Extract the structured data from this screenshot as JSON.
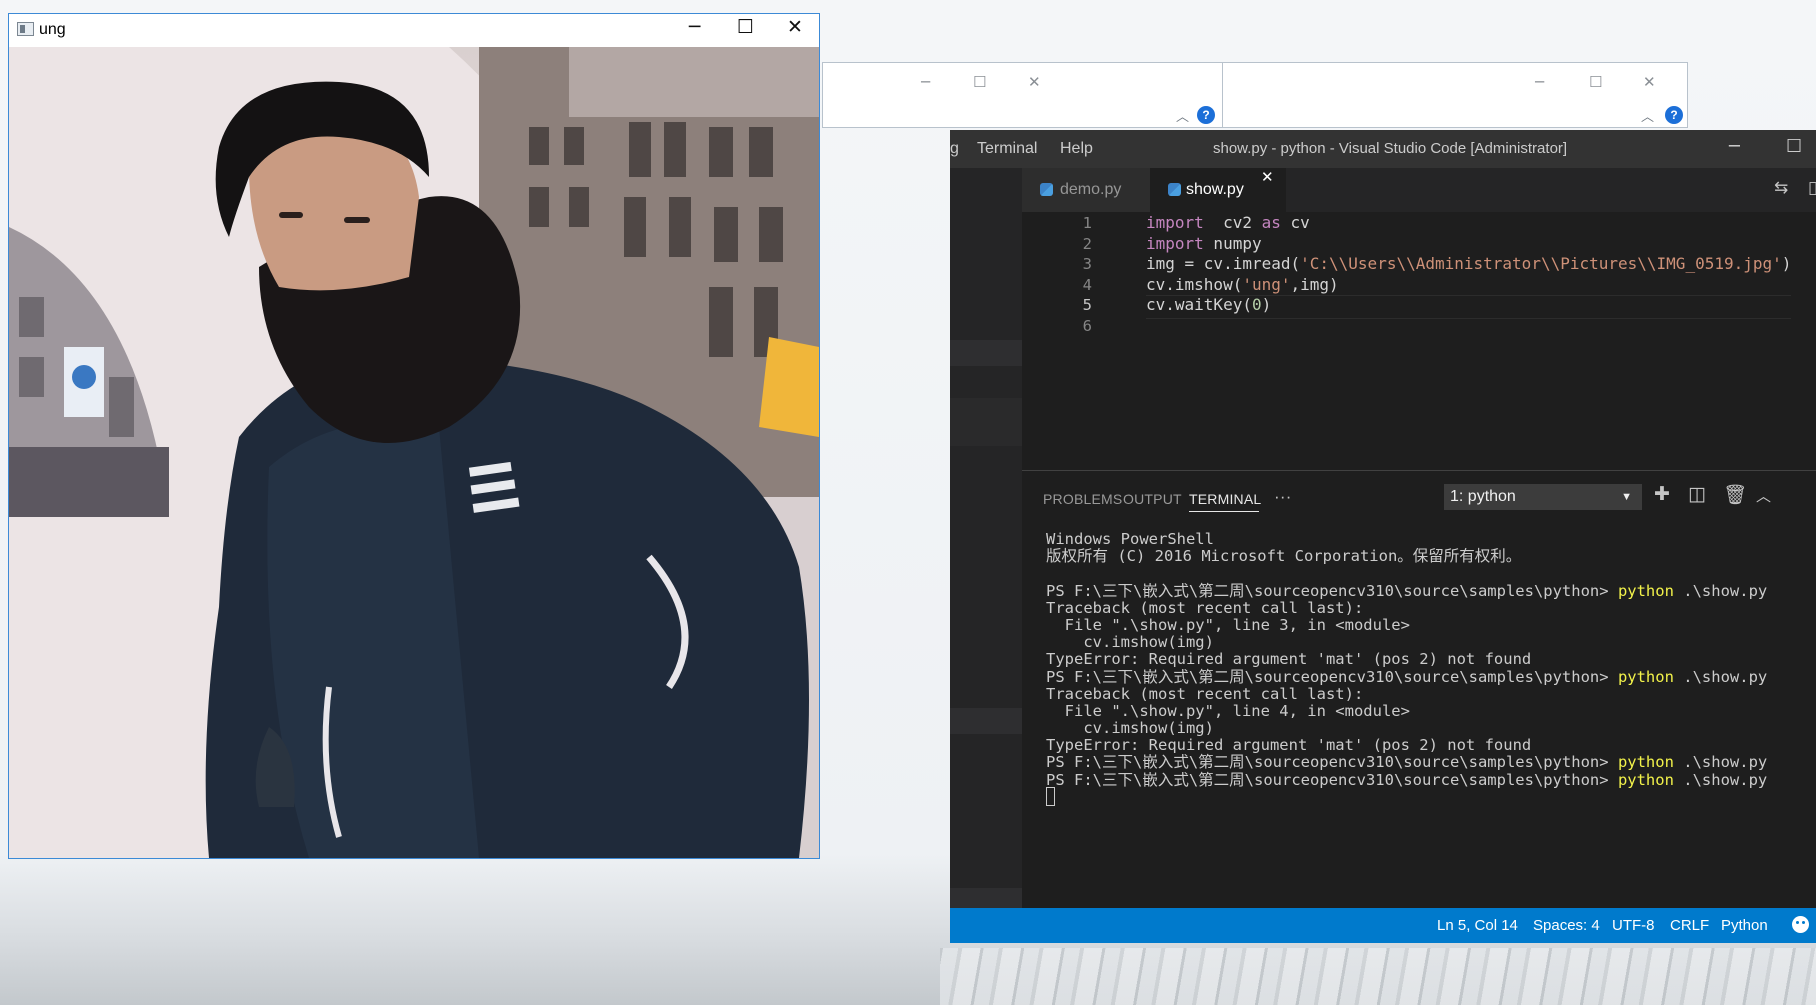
{
  "image_window": {
    "title": "ung",
    "controls": {
      "minimize": "─",
      "maximize": "☐",
      "close": "✕"
    }
  },
  "bg_windows": [
    {
      "minimize": "─",
      "maximize": "☐",
      "close": "✕",
      "chevron": "︿",
      "help": "?"
    },
    {
      "minimize": "─",
      "maximize": "☐",
      "close": "✕",
      "chevron": "︿",
      "help": "?"
    }
  ],
  "vscode": {
    "menu": [
      "g",
      "Terminal",
      "Help"
    ],
    "window_title": "show.py - python - Visual Studio Code [Administrator]",
    "window_controls": {
      "minimize": "─",
      "maximize": "☐"
    },
    "tabs": [
      {
        "label": "demo.py",
        "active": false
      },
      {
        "label": "show.py",
        "active": true,
        "close": "✕"
      }
    ],
    "code_lines": [
      {
        "n": "1",
        "parts": [
          [
            "kw",
            "import"
          ],
          [
            "",
            "  cv2 "
          ],
          [
            "kw",
            "as"
          ],
          [
            "",
            " cv"
          ]
        ]
      },
      {
        "n": "2",
        "parts": [
          [
            "kw",
            "import"
          ],
          [
            "",
            " numpy"
          ]
        ]
      },
      {
        "n": "3",
        "parts": [
          [
            "",
            "img = cv.imread("
          ],
          [
            "str",
            "'C:\\\\Users\\\\Administrator\\\\Pictures\\\\IMG_0519.jpg'"
          ],
          [
            "",
            ")"
          ]
        ]
      },
      {
        "n": "4",
        "parts": [
          [
            "",
            "cv.imshow("
          ],
          [
            "str",
            "'ung'"
          ],
          [
            "",
            ",img)"
          ]
        ]
      },
      {
        "n": "5",
        "parts": [
          [
            "",
            "cv.waitKey("
          ],
          [
            "num",
            "0"
          ],
          [
            "",
            ")"
          ]
        ]
      },
      {
        "n": "6",
        "parts": []
      }
    ],
    "panel": {
      "tabs": [
        "PROBLEMS",
        "OUTPUT",
        "TERMINAL"
      ],
      "active_tab": "TERMINAL",
      "more": "···",
      "terminal_select": "1: python",
      "terminal_lines": [
        [
          [
            "",
            "Windows PowerShell"
          ]
        ],
        [
          [
            "",
            "版权所有 (C) 2016 Microsoft Corporation。保留所有权利。"
          ]
        ],
        [
          [
            "",
            ""
          ]
        ],
        [
          [
            "",
            "PS F:\\三下\\嵌入式\\第二周\\sourceopencv310\\source\\samples\\python> "
          ],
          [
            "yel",
            "python"
          ],
          [
            "",
            " .\\show.py"
          ]
        ],
        [
          [
            "",
            "Traceback (most recent call last):"
          ]
        ],
        [
          [
            "",
            "  File \".\\show.py\", line 3, in <module>"
          ]
        ],
        [
          [
            "",
            "    cv.imshow(img)"
          ]
        ],
        [
          [
            "",
            "TypeError: Required argument 'mat' (pos 2) not found"
          ]
        ],
        [
          [
            "",
            "PS F:\\三下\\嵌入式\\第二周\\sourceopencv310\\source\\samples\\python> "
          ],
          [
            "yel",
            "python"
          ],
          [
            "",
            " .\\show.py"
          ]
        ],
        [
          [
            "",
            "Traceback (most recent call last):"
          ]
        ],
        [
          [
            "",
            "  File \".\\show.py\", line 4, in <module>"
          ]
        ],
        [
          [
            "",
            "    cv.imshow(img)"
          ]
        ],
        [
          [
            "",
            "TypeError: Required argument 'mat' (pos 2) not found"
          ]
        ],
        [
          [
            "",
            "PS F:\\三下\\嵌入式\\第二周\\sourceopencv310\\source\\samples\\python> "
          ],
          [
            "yel",
            "python"
          ],
          [
            "",
            " .\\show.py"
          ]
        ],
        [
          [
            "",
            "PS F:\\三下\\嵌入式\\第二周\\sourceopencv310\\source\\samples\\python> "
          ],
          [
            "yel",
            "python"
          ],
          [
            "",
            " .\\show.py"
          ]
        ]
      ]
    },
    "status": {
      "position": "Ln 5, Col 14",
      "spaces": "Spaces: 4",
      "encoding": "UTF-8",
      "eol": "CRLF",
      "language": "Python"
    },
    "colors": {
      "status_bar": "#007acc",
      "title_bar": "#333333",
      "editor_bg": "#1e1e1e"
    }
  }
}
